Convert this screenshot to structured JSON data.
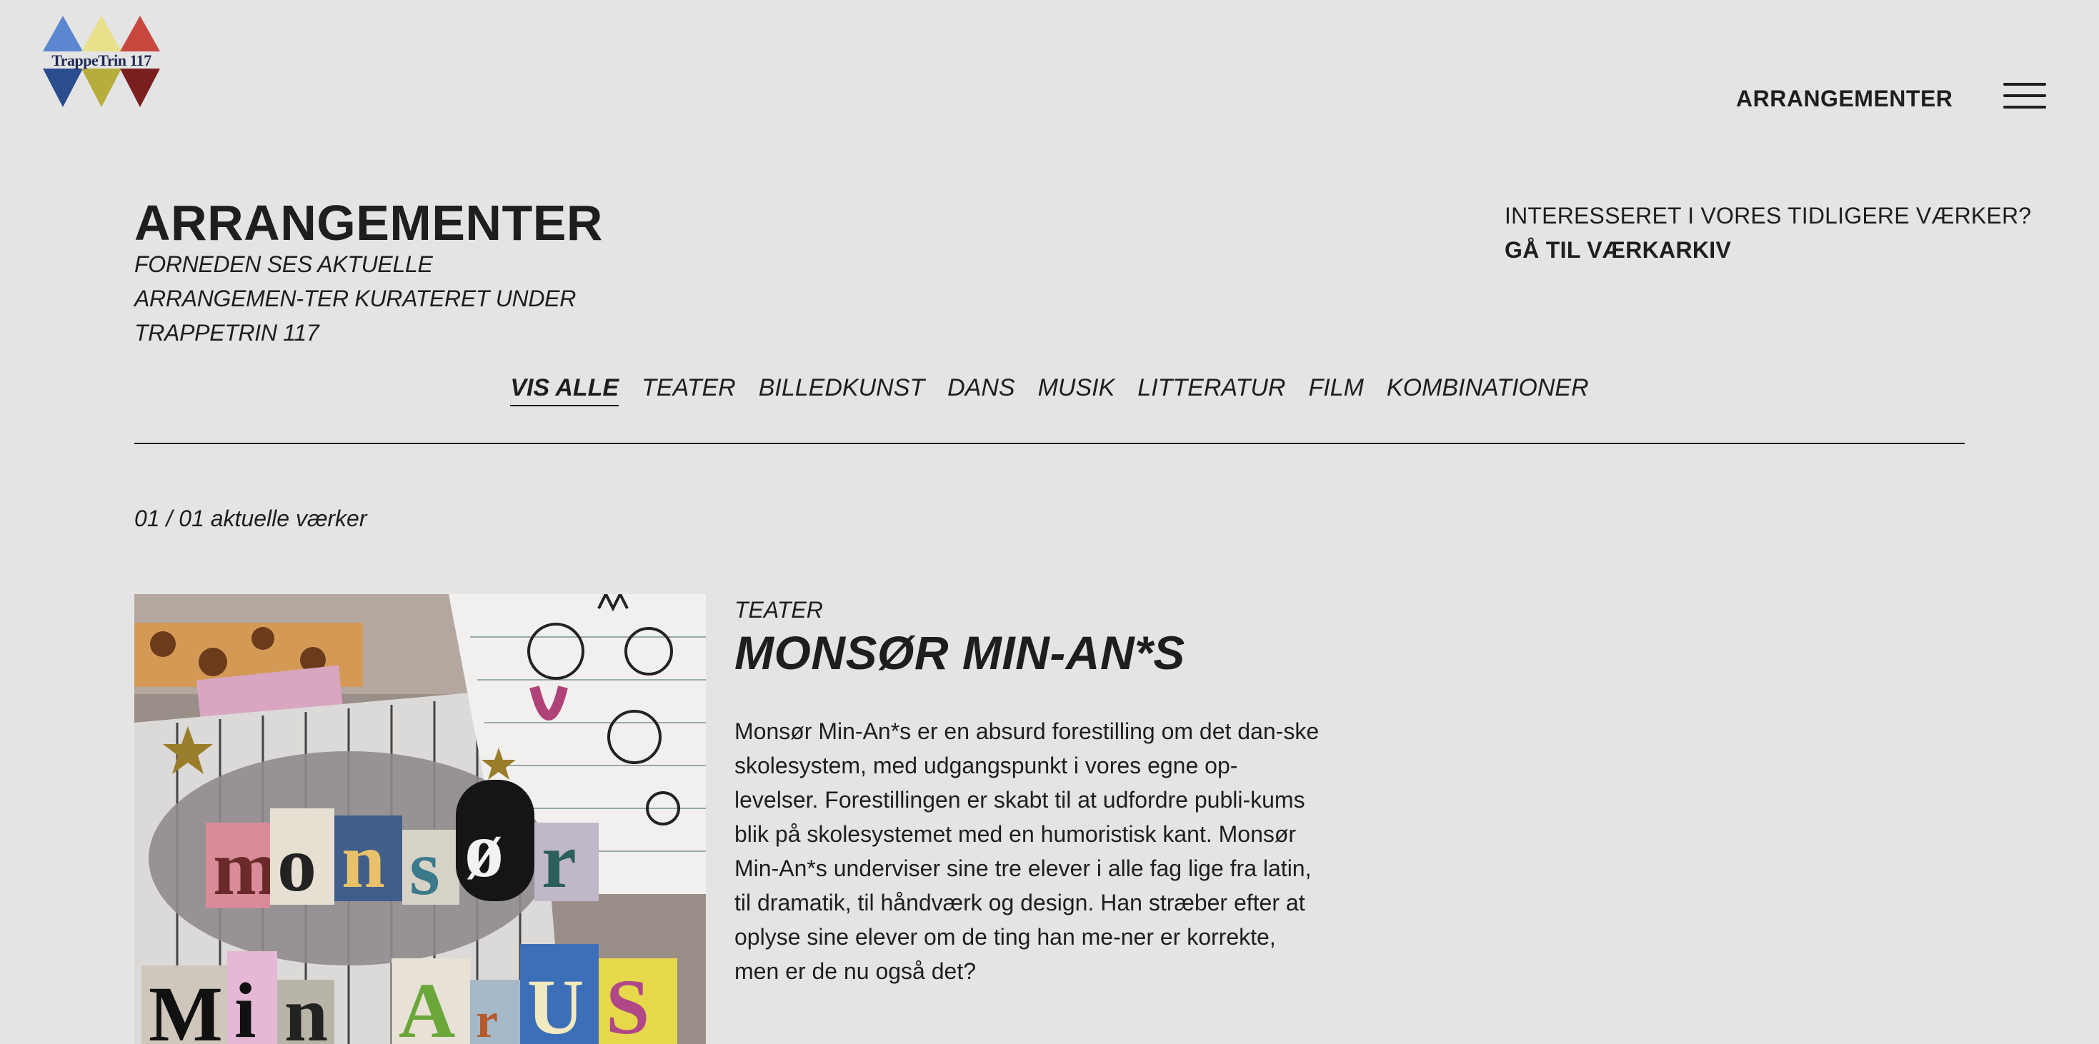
{
  "header": {
    "logo_text": "TrappeTrin 117",
    "nav_link": "ARRANGEMENTER",
    "menu_icon": "hamburger-icon"
  },
  "intro": {
    "title": "ARRANGEMENTER",
    "subtitle": "FORNEDEN SES AKTUELLE ARRANGEMEN-TER KURATERET UNDER TRAPPETRIN 117",
    "archive_question": "INTERESSERET I VORES TIDLIGERE VÆRKER?",
    "archive_link": "GÅ TIL VÆRKARKIV"
  },
  "filters": [
    {
      "label": "VIS ALLE",
      "active": true
    },
    {
      "label": "TEATER",
      "active": false
    },
    {
      "label": "BILLEDKUNST",
      "active": false
    },
    {
      "label": "DANS",
      "active": false
    },
    {
      "label": "MUSIK",
      "active": false
    },
    {
      "label": "LITTERATUR",
      "active": false
    },
    {
      "label": "FILM",
      "active": false
    },
    {
      "label": "KOMBINATIONER",
      "active": false
    }
  ],
  "count_text": "01 / 01 aktuelle værker",
  "event": {
    "category": "TEATER",
    "title": "MONSØR MIN-AN*S",
    "description": "Monsør Min-An*s er en absurd forestilling om det dan-ske skolesystem, med udgangspunkt i vores egne op-levelser. Forestillingen er skabt til at udfordre publi-kums blik på skolesystemet med en humoristisk kant. Monsør Min-An*s underviser sine tre elever i alle fag lige fra latin, til dramatik, til håndværk og design. Han stræber efter at oplyse sine elever om de ting han me-ner er korrekte, men er de nu også det?",
    "poster_letters": [
      "m",
      "o",
      "n",
      "s",
      "ø",
      "r",
      "M",
      "i",
      "n",
      "A",
      "r",
      "U",
      "S"
    ]
  },
  "colors": {
    "background": "#e4e4e4",
    "text": "#1e1e1e",
    "logo_blue": "#5b86d0",
    "logo_yellow": "#e8e08a",
    "logo_red": "#c8463d"
  }
}
